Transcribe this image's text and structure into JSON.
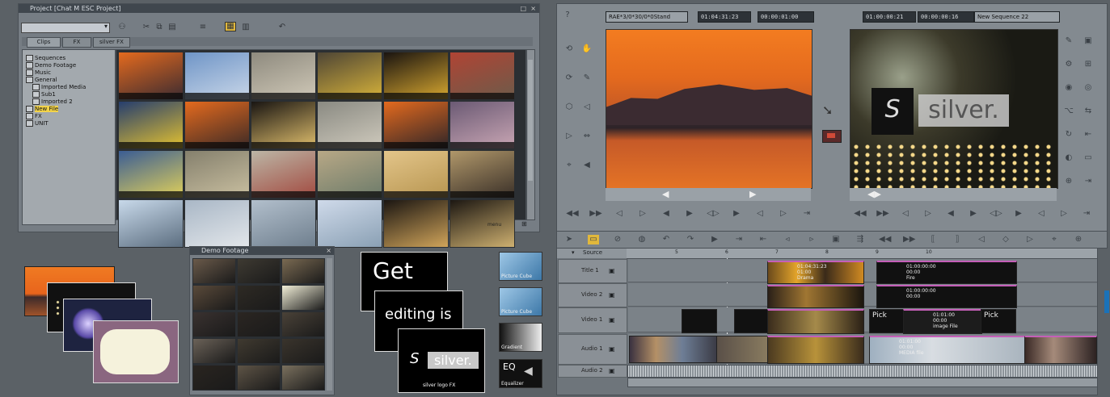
{
  "project_window": {
    "title": "Project [Chat M ESC Project]",
    "tabs": [
      "Clips",
      "FX",
      "silver FX"
    ],
    "tree": [
      {
        "label": "Sequences",
        "indent": 0
      },
      {
        "label": "Demo Footage",
        "indent": 0
      },
      {
        "label": "Music",
        "indent": 0
      },
      {
        "label": "General",
        "indent": 0
      },
      {
        "label": "Imported Media",
        "indent": 1
      },
      {
        "label": "Sub1",
        "indent": 1
      },
      {
        "label": "Imported 2",
        "indent": 1
      },
      {
        "label": "New File",
        "indent": 0,
        "selected": true
      },
      {
        "label": "FX",
        "indent": 0
      },
      {
        "label": "UNIT",
        "indent": 0
      }
    ],
    "status": "menu"
  },
  "demo_bin": {
    "title": "Demo Footage"
  },
  "source_viewer": {
    "dropdown": "RAE*3/0*30/0*0Stand",
    "timecode_in": "01:04:31:23",
    "timecode_dur": "00:00:01:00"
  },
  "record_viewer": {
    "timecode_in": "01:00:00:21",
    "timecode_dur": "00:00:00:16",
    "dropdown": "New Sequence 22",
    "logo_text": "silver."
  },
  "title_cards": {
    "card1": "Get",
    "card2": "editing is",
    "card3": "silver.",
    "card3_caption": "silver logo FX"
  },
  "effects": [
    {
      "label": "Picture Cube"
    },
    {
      "label": "Picture Cube"
    },
    {
      "label": "Gradient"
    },
    {
      "label": "Equalizer",
      "big": "EQ"
    }
  ],
  "timeline": {
    "header_label": "Source",
    "ruler": [
      "5",
      "6",
      "7",
      "8",
      "9",
      "10"
    ],
    "tracks": [
      {
        "name": "Title 1"
      },
      {
        "name": "Video 2"
      },
      {
        "name": "Video 1"
      },
      {
        "name": "Audio 1"
      },
      {
        "name": "Audio 2"
      }
    ],
    "clip_texts": {
      "t1a": "01:04:31:23\n01:00\nDrama",
      "t1b": "01:00:00:00\n00:00\nFire",
      "t2b": "01:00:00:00\n00:00",
      "v1b": "01:01:00\n00:00\nimage File",
      "a1b": "01:01:00\n00:00\nMEDIA file"
    },
    "pick_label": "Pick"
  }
}
